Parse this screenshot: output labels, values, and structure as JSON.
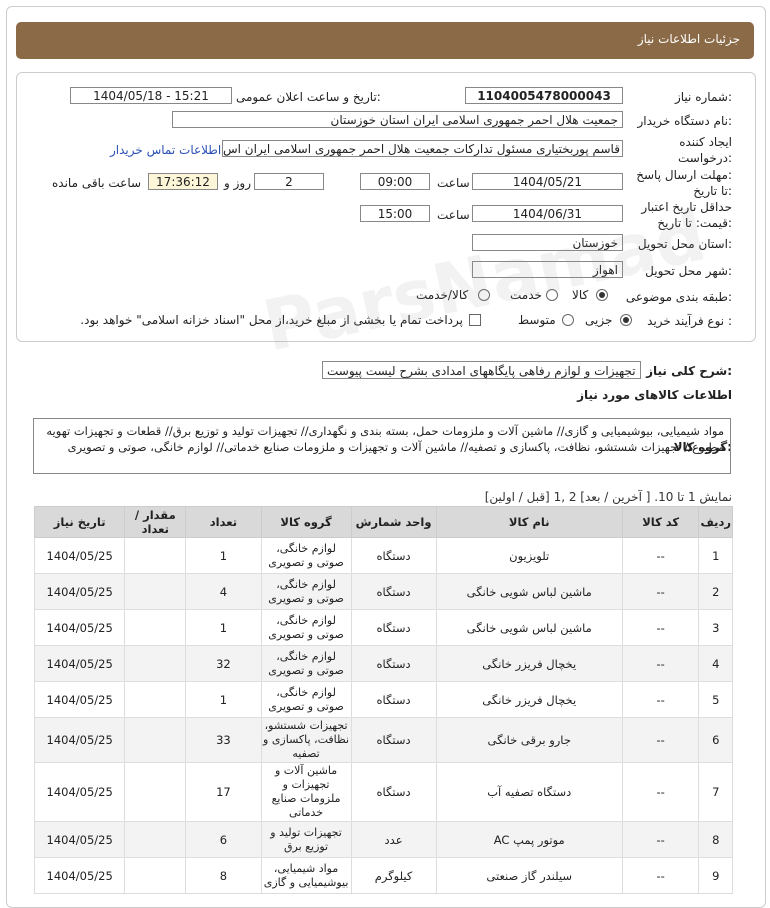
{
  "header": {
    "title": "جزئیات اطلاعات نیاز"
  },
  "need": {
    "number_label": "شماره نیاز:",
    "number": "1104005478000043",
    "announce_label": "تاریخ و ساعت اعلان عمومی:",
    "announce_value": "1404/05/18 - 15:21",
    "buyer_label": "نام دستگاه خریدار:",
    "buyer_value": "جمعیت هلال احمر جمهوری اسلامی ایران استان خوزستان",
    "creator_label_1": "ایجاد کننده",
    "creator_label_2": "درخواست:",
    "creator_value": "قاسم پوربختیاری مسئول تدارکات جمعیت هلال احمر جمهوری اسلامی ایران اس",
    "contact_link": "اطلاعات تماس خریدار",
    "reply_label_1": "مهلت ارسال پاسخ:",
    "reply_label_2": "تا تاریخ:",
    "reply_date": "1404/05/21",
    "time_word": "ساعت",
    "reply_time": "09:00",
    "days_value": "2",
    "days_word": "روز و",
    "remaining_value": "17:36:12",
    "remaining_word": "ساعت باقی مانده",
    "validity_label_1": "حداقل تاریخ اعتبار",
    "validity_label_2": "قیمت: تا تاریخ:",
    "validity_date": "1404/06/31",
    "validity_time": "15:00",
    "province_label": "استان محل تحویل:",
    "province_value": "خوزستان",
    "city_label": "شهر محل تحویل:",
    "city_value": "اهواز",
    "category_label": "طبقه بندی موضوعی:",
    "category_options": [
      "کالا",
      "خدمت",
      "کالا/خدمت"
    ],
    "process_label": "نوع فرآیند خرید :",
    "process_options": [
      "جزیی",
      "متوسط"
    ],
    "payment_note": "پرداخت تمام یا بخشی از مبلغ خرید،از محل \"اسناد خزانه اسلامی\" خواهد بود."
  },
  "description": {
    "label": "شرح کلی نیاز:",
    "value": "تجهیزات و لوازم رفاهی پایگاههای امدادی بشرح لیست پیوست"
  },
  "goods": {
    "section_title": "اطلاعات کالاهای مورد نیاز",
    "group_label": "گروه کالا:",
    "group_value": "مواد شیمیایی، بیوشیمیایی و گازی// ماشین آلات و ملزومات حمل، بسته بندی و نگهداری// تجهیزات تولید و توزیع برق// قطعات و تجهیزات تهویه مطبوع// تجهیزات شستشو، نظافت، پاکسازی و تصفیه// ماشین آلات و تجهیزات و ملزومات صنایع خدماتی// لوازم خانگی، صوتی و تصویری",
    "pagination": "نمایش 1 تا 10. [ آخرین / بعد] 2 ,1 [قبل / اولین]"
  },
  "table": {
    "headers": [
      "ردیف",
      "کد کالا",
      "نام کالا",
      "واحد شمارش",
      "گروه کالا",
      "تعداد",
      "مقدار / تعداد",
      "تاریخ نیاز"
    ],
    "rows": [
      {
        "no": "1",
        "code": "--",
        "name": "تلویزیون",
        "unit": "دستگاه",
        "group": "لوازم خانگی، صوتی و تصویری",
        "qty": "1",
        "date": "1404/05/25"
      },
      {
        "no": "2",
        "code": "--",
        "name": "ماشین لباس شویی خانگی",
        "unit": "دستگاه",
        "group": "لوازم خانگی، صوتی و تصویری",
        "qty": "4",
        "date": "1404/05/25"
      },
      {
        "no": "3",
        "code": "--",
        "name": "ماشین لباس شویی خانگی",
        "unit": "دستگاه",
        "group": "لوازم خانگی، صوتی و تصویری",
        "qty": "1",
        "date": "1404/05/25"
      },
      {
        "no": "4",
        "code": "--",
        "name": "یخچال فریزر خانگی",
        "unit": "دستگاه",
        "group": "لوازم خانگی، صوتی و تصویری",
        "qty": "32",
        "date": "1404/05/25"
      },
      {
        "no": "5",
        "code": "--",
        "name": "یخچال فریزر خانگی",
        "unit": "دستگاه",
        "group": "لوازم خانگی، صوتی و تصویری",
        "qty": "1",
        "date": "1404/05/25"
      },
      {
        "no": "6",
        "code": "--",
        "name": "جارو برقی خانگی",
        "unit": "دستگاه",
        "group": "تجهیزات شستشو، نظافت، پاکسازی و تصفیه",
        "qty": "33",
        "date": "1404/05/25"
      },
      {
        "no": "7",
        "code": "--",
        "name": "دستگاه تصفیه آب",
        "unit": "دستگاه",
        "group": "ماشین آلات و تجهیزات و ملزومات صنایع خدماتی",
        "qty": "17",
        "date": "1404/05/25"
      },
      {
        "no": "8",
        "code": "--",
        "name": "موتور پمپ AC",
        "unit": "عدد",
        "group": "تجهیزات تولید و توزیع برق",
        "qty": "6",
        "date": "1404/05/25"
      },
      {
        "no": "9",
        "code": "--",
        "name": "سیلندر گاز صنعتی",
        "unit": "کیلوگرم",
        "group": "مواد شیمیایی، بیوشیمیایی و گازی",
        "qty": "8",
        "date": "1404/05/25"
      }
    ]
  }
}
